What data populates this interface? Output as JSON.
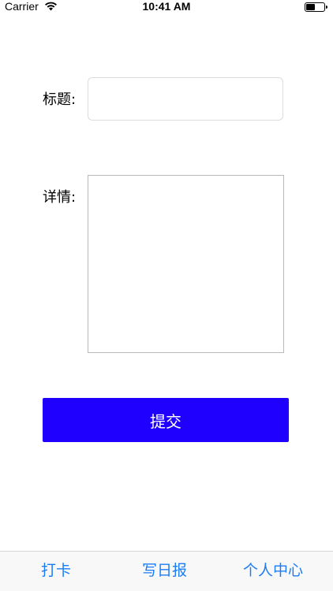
{
  "status_bar": {
    "carrier": "Carrier",
    "time": "10:41 AM",
    "icons": [
      "wifi-icon",
      "battery-icon"
    ]
  },
  "form": {
    "title_label": "标题:",
    "title_value": "",
    "detail_label": "详情:",
    "detail_value": "",
    "submit_label": "提交",
    "submit_color": "#1f00ff"
  },
  "tab_bar": {
    "tint_color": "#1c7cf4",
    "tabs": [
      {
        "label": "打卡"
      },
      {
        "label": "写日报"
      },
      {
        "label": "个人中心"
      }
    ]
  }
}
